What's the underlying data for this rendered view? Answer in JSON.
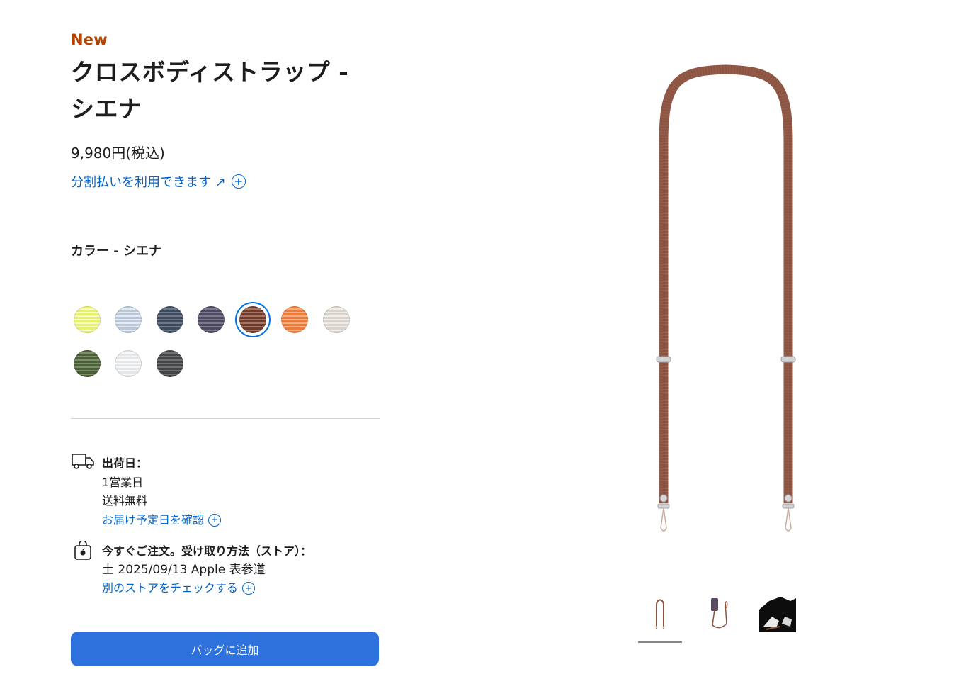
{
  "product": {
    "badge": "New",
    "title": "クロスボディストラップ - シエナ",
    "price": "9,980円(税込)",
    "installment_link": "分割払いを利用できます ↗"
  },
  "color": {
    "label": "カラー - シエナ",
    "swatches": [
      {
        "name": "yellow",
        "color": "#e6f26a",
        "selected": false
      },
      {
        "name": "light-blue",
        "color": "#b9c7d8",
        "selected": false
      },
      {
        "name": "navy",
        "color": "#3e4a5e",
        "selected": false
      },
      {
        "name": "purple",
        "color": "#4d4a60",
        "selected": false
      },
      {
        "name": "sienna",
        "color": "#7b4a38",
        "selected": true
      },
      {
        "name": "orange",
        "color": "#ee7a3a",
        "selected": false
      },
      {
        "name": "stone",
        "color": "#d8d4cd",
        "selected": false
      },
      {
        "name": "green",
        "color": "#4a5e3a",
        "selected": false
      },
      {
        "name": "white",
        "color": "#e4e6e8",
        "selected": false
      },
      {
        "name": "black",
        "color": "#444546",
        "selected": false
      }
    ]
  },
  "shipping": {
    "label": "出荷日：",
    "days": "1営業日",
    "free": "送料無料",
    "link": "お届け予定日を確認"
  },
  "pickup": {
    "label": "今すぐご注文。受け取り方法（ストア）：",
    "date": "土 2025/09/13 Apple 表参道",
    "link": "別のストアをチェックする"
  },
  "cta": {
    "add_to_bag": "バッグに追加"
  },
  "colors": {
    "accent": "#0066cc",
    "button": "#2d71dc",
    "badge": "#b64400",
    "strap": "#8b5443"
  }
}
